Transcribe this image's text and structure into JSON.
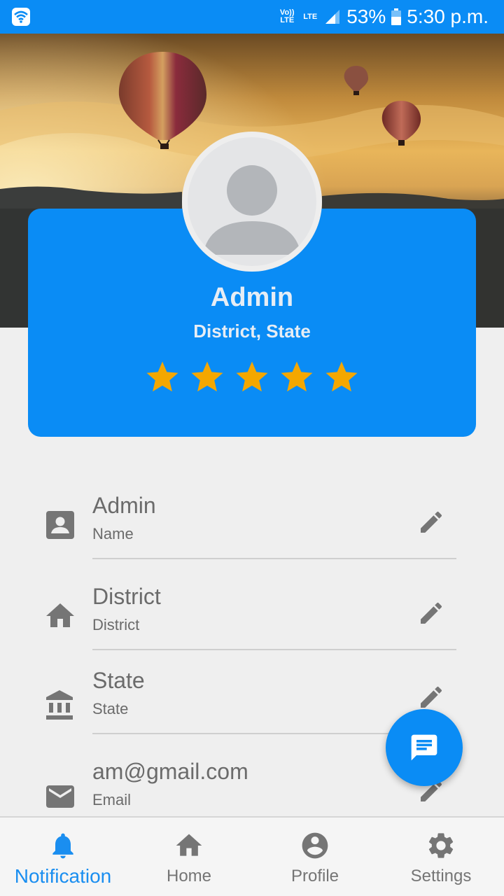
{
  "status_bar": {
    "volte": "Vo)) LTE",
    "lte": "LTE",
    "battery": "53%",
    "time": "5:30 p.m."
  },
  "profile": {
    "name": "Admin",
    "location": "District, State",
    "rating": 5,
    "rating_max": 5
  },
  "fields": [
    {
      "value": "Admin",
      "label": "Name",
      "icon": "contact-card-icon"
    },
    {
      "value": "District",
      "label": "District",
      "icon": "home-icon"
    },
    {
      "value": "State",
      "label": "State",
      "icon": "bank-icon"
    },
    {
      "value": "am@gmail.com",
      "label": "Email",
      "icon": "mail-icon"
    }
  ],
  "nav": [
    {
      "label": "Notification",
      "icon": "bell-icon",
      "active": true
    },
    {
      "label": "Home",
      "icon": "home-icon"
    },
    {
      "label": "Profile",
      "icon": "account-circle-icon"
    },
    {
      "label": "Settings",
      "icon": "gear-icon"
    }
  ],
  "colors": {
    "primary": "#0a8cf5",
    "star": "#f4a700",
    "icon_gray": "#757575",
    "background": "#efefef"
  }
}
